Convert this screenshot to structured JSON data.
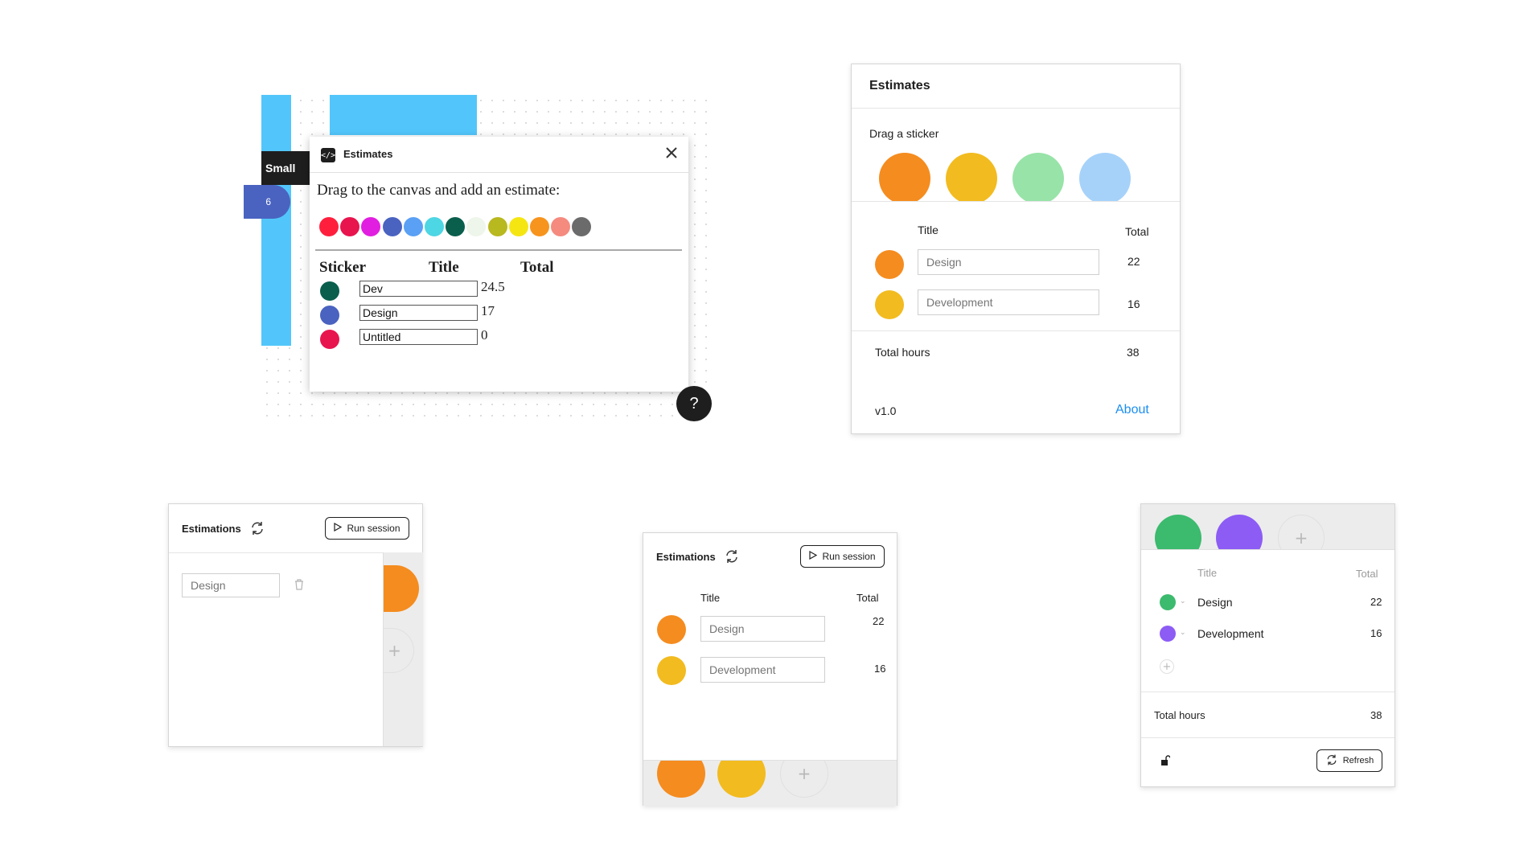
{
  "p1": {
    "canvas_tag": "Small",
    "canvas_badge": "6",
    "title": "Estimates",
    "instruction": "Drag to the canvas and add an estimate:",
    "palette": [
      "#ff1f3d",
      "#e8144e",
      "#e11fe0",
      "#4a63c0",
      "#5aa0f5",
      "#4dd6e3",
      "#0a5e4c",
      "#eef5ea",
      "#b8b81f",
      "#f5e612",
      "#f7941d",
      "#f58a7e",
      "#6b6b6b"
    ],
    "columns": {
      "sticker": "Sticker",
      "title": "Title",
      "total": "Total"
    },
    "rows": [
      {
        "color": "#0a5e4c",
        "title": "Dev",
        "total": "24.5"
      },
      {
        "color": "#4a63c0",
        "title": "Design",
        "total": "17"
      },
      {
        "color": "#e8144e",
        "title": "Untitled",
        "total": "0"
      }
    ],
    "help": "?"
  },
  "p2": {
    "title": "Estimates",
    "drag_label": "Drag a sticker",
    "stickers": [
      "#f58c1f",
      "#f2bb1f",
      "#98e3a8",
      "#a6d2fa"
    ],
    "columns": {
      "title": "Title",
      "total": "Total"
    },
    "rows": [
      {
        "color": "#f58c1f",
        "placeholder": "Design",
        "total": "22"
      },
      {
        "color": "#f2bb1f",
        "placeholder": "Development",
        "total": "16"
      }
    ],
    "total_label": "Total hours",
    "total_value": "38",
    "version": "v1.0",
    "about": "About"
  },
  "p3": {
    "title": "Estimations",
    "run": "Run session",
    "placeholder": "Design",
    "sticker_color": "#f58c1f"
  },
  "p4": {
    "title": "Estimations",
    "run": "Run session",
    "columns": {
      "title": "Title",
      "total": "Total"
    },
    "rows": [
      {
        "color": "#f58c1f",
        "placeholder": "Design",
        "total": "22"
      },
      {
        "color": "#f2bb1f",
        "placeholder": "Development",
        "total": "16"
      }
    ],
    "stickers": [
      "#f58c1f",
      "#f2bb1f"
    ]
  },
  "p5": {
    "stickers": [
      "#3cba6e",
      "#8c5cf5"
    ],
    "columns": {
      "title": "Title",
      "total": "Total"
    },
    "rows": [
      {
        "color": "#3cba6e",
        "title": "Design",
        "total": "22"
      },
      {
        "color": "#8c5cf5",
        "title": "Development",
        "total": "16"
      }
    ],
    "total_label": "Total hours",
    "total_value": "38",
    "refresh": "Refresh"
  }
}
